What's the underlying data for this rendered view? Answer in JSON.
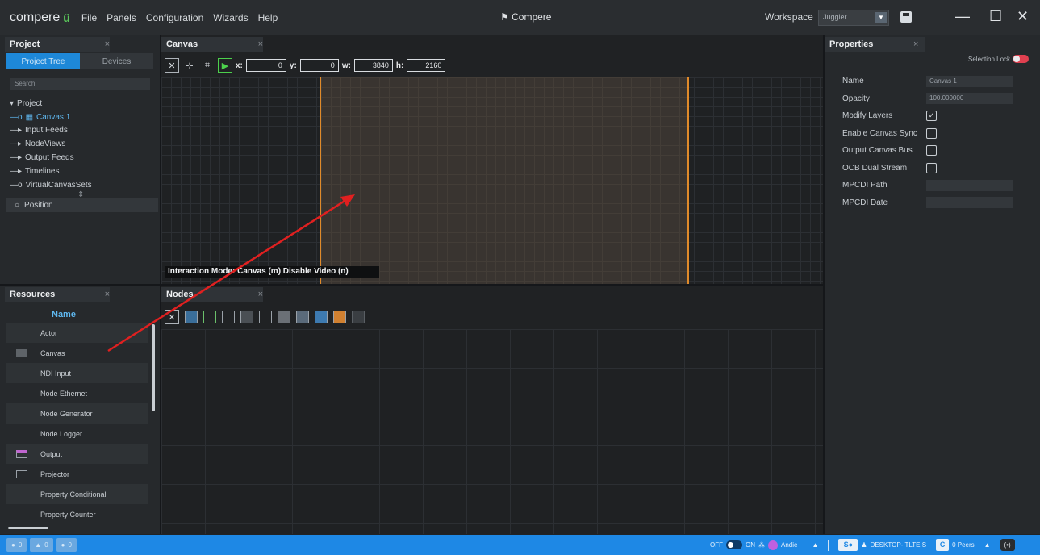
{
  "titlebar": {
    "logo": "compere",
    "menu": [
      "File",
      "Panels",
      "Configuration",
      "Wizards",
      "Help"
    ],
    "app_title": "Compere",
    "workspace_label": "Workspace",
    "workspace_value": "Juggler",
    "minimize": "—",
    "maximize": "☐",
    "close": "✕"
  },
  "project": {
    "title": "Project",
    "tabs": [
      "Project Tree",
      "Devices"
    ],
    "search_placeholder": "Search",
    "tree": [
      "Project",
      "Canvas 1",
      "Input Feeds",
      "NodeViews",
      "Output Feeds",
      "Timelines",
      "VirtualCanvasSets"
    ],
    "position": "Position"
  },
  "canvas": {
    "title": "Canvas",
    "x_label": "x:",
    "x": "0",
    "y_label": "y:",
    "y": "0",
    "w_label": "w:",
    "w": "3840",
    "h_label": "h:",
    "h": "2160",
    "interaction_mode": "Interaction Mode: Canvas (m) Disable Video (n)"
  },
  "resources": {
    "title": "Resources",
    "column": "Name",
    "items": [
      "Actor",
      "Canvas",
      "NDI Input",
      "Node Ethernet",
      "Node Generator",
      "Node Logger",
      "Output",
      "Projector",
      "Property Conditional",
      "Property Counter"
    ]
  },
  "nodes": {
    "title": "Nodes"
  },
  "properties": {
    "title": "Properties",
    "selection_lock": "Selection Lock",
    "rows": [
      {
        "label": "Name",
        "value": "Canvas 1"
      },
      {
        "label": "Opacity",
        "value": "100.000000"
      },
      {
        "label": "Modify Layers",
        "checked": true
      },
      {
        "label": "Enable Canvas Sync",
        "checked": false
      },
      {
        "label": "Output Canvas Bus",
        "checked": false
      },
      {
        "label": "OCB Dual Stream",
        "checked": false
      },
      {
        "label": "MPCDI Path",
        "value": ""
      },
      {
        "label": "MPCDI Date",
        "value": ""
      }
    ]
  },
  "statusbar": {
    "chips": [
      "0",
      "0",
      "0"
    ],
    "off": "OFF",
    "on": "ON",
    "user": "Andie",
    "device": "DESKTOP-ITLTEIS",
    "peers": "0 Peers"
  },
  "colors": {
    "accent": "#1e88e5",
    "canvas_border": "#e08a2a",
    "arrow": "#e02020"
  }
}
